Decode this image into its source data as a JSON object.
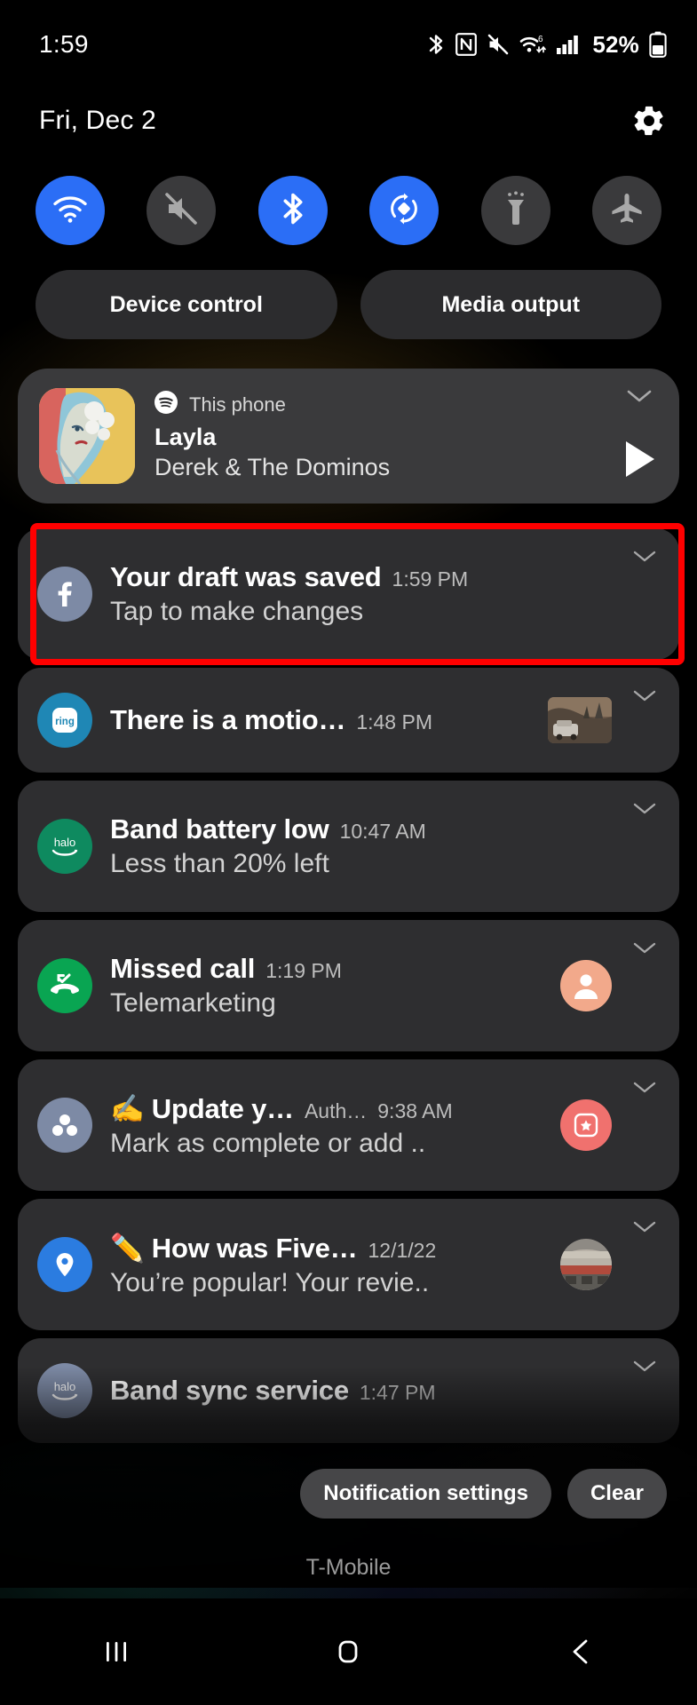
{
  "statusbar": {
    "clock": "1:59",
    "battery_percent": "52%",
    "icons": [
      "bluetooth-icon",
      "nfc-icon",
      "mute-icon",
      "wifi-icon",
      "cellular-signal-icon",
      "battery-icon"
    ]
  },
  "header": {
    "date": "Fri, Dec 2",
    "settings_icon": "gear-icon"
  },
  "quick_settings": {
    "tiles": [
      {
        "name": "wifi",
        "icon": "wifi-icon",
        "state": "on"
      },
      {
        "name": "sound",
        "icon": "mute-icon",
        "state": "off"
      },
      {
        "name": "bluetooth",
        "icon": "bluetooth-icon",
        "state": "on"
      },
      {
        "name": "auto-rotate",
        "icon": "auto-rotate-icon",
        "state": "on"
      },
      {
        "name": "flashlight",
        "icon": "flashlight-icon",
        "state": "off"
      },
      {
        "name": "airplane",
        "icon": "airplane-icon",
        "state": "off"
      }
    ]
  },
  "pills": {
    "device_control": "Device control",
    "media_output": "Media output"
  },
  "media": {
    "source_icon": "spotify-icon",
    "source": "This phone",
    "title": "Layla",
    "artist": "Derek & The Dominos",
    "play_icon": "play-icon",
    "collapse_icon": "chevron-down-icon",
    "album_art": "layla-album-cover"
  },
  "notifications": [
    {
      "id": "facebook-draft",
      "icon": "facebook-icon",
      "icon_bg": "#7D8AA5",
      "title": "Your draft was saved",
      "time": "1:59 PM",
      "app": "",
      "subtitle": "Tap to make changes",
      "thumb": "",
      "highlighted": true
    },
    {
      "id": "ring-motion",
      "icon": "ring-icon",
      "icon_bg": "#1F87B5",
      "title": "There is a motio…",
      "time": "1:48 PM",
      "app": "",
      "subtitle": "",
      "thumb": "camera-snapshot",
      "highlighted": false
    },
    {
      "id": "halo-band-battery",
      "icon": "halo-icon",
      "icon_bg": "#0E8A5F",
      "title": "Band battery low",
      "time": "10:47 AM",
      "app": "",
      "subtitle": "Less than 20% left",
      "thumb": "",
      "highlighted": false
    },
    {
      "id": "missed-call",
      "icon": "missed-call-icon",
      "icon_bg": "#09A552",
      "title": "Missed call",
      "time": "1:19 PM",
      "app": "",
      "subtitle": "Telemarketing",
      "thumb": "contact-avatar",
      "highlighted": false
    },
    {
      "id": "asana-task",
      "icon": "asana-icon",
      "icon_bg": "#7D8AA5",
      "title": "✍️ Update y…",
      "time": "9:38 AM",
      "app": "Auth…",
      "subtitle": "Mark as complete or add ..",
      "thumb": "task-badge",
      "highlighted": false
    },
    {
      "id": "maps-review",
      "icon": "maps-pin-icon",
      "icon_bg": "#2B7CE0",
      "title": "✏️ How was Five…",
      "time": "12/1/22",
      "app": "",
      "subtitle": "You’re popular! Your revie..",
      "thumb": "place-photo",
      "highlighted": false
    },
    {
      "id": "halo-band-sync",
      "icon": "halo-icon-gray",
      "icon_bg": "#7D8AA5",
      "title": "Band sync service",
      "time": "1:47 PM",
      "app": "",
      "subtitle": "",
      "thumb": "",
      "highlighted": false
    }
  ],
  "footer": {
    "notification_settings": "Notification settings",
    "clear": "Clear",
    "carrier": "T-Mobile"
  },
  "navbar": {
    "recents": "recents-icon",
    "home": "home-icon",
    "back": "back-icon"
  },
  "colors": {
    "accent_blue": "#2B6EF6",
    "highlight_red": "#FF0000",
    "card_bg": "#2E2E30",
    "tile_off": "#3A3A3C"
  }
}
